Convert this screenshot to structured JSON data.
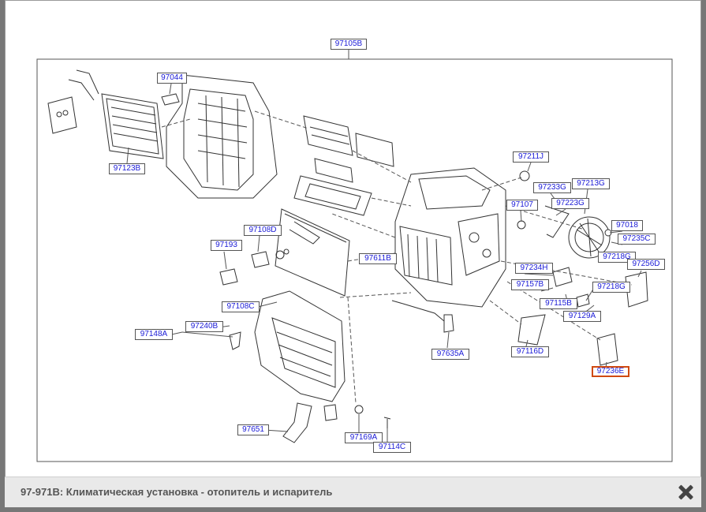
{
  "caption": "97-971B: Климатическая установка - отопитель и испаритель",
  "selected_part": "97236E",
  "labels": {
    "main": "97105B",
    "p97044": "97044",
    "p97123B": "97123B",
    "p97211J": "97211J",
    "p97233G": "97233G",
    "p97213G": "97213G",
    "p97107": "97107",
    "p97223G": "97223G",
    "p97018": "97018",
    "p97235C": "97235C",
    "p97218G_a": "97218G",
    "p97256D": "97256D",
    "p97108D": "97108D",
    "p97193": "97193",
    "p97611B": "97611B",
    "p97234H": "97234H",
    "p97157B": "97157B",
    "p97218G_b": "97218G",
    "p97115B": "97115B",
    "p97129A": "97129A",
    "p97108C": "97108C",
    "p97240B": "97240B",
    "p97148A": "97148A",
    "p97635A": "97635A",
    "p97116D": "97116D",
    "p97236E": "97236E",
    "p97651": "97651",
    "p97169A": "97169A",
    "p97114C": "97114C"
  },
  "icons": {
    "close": "close-icon"
  }
}
